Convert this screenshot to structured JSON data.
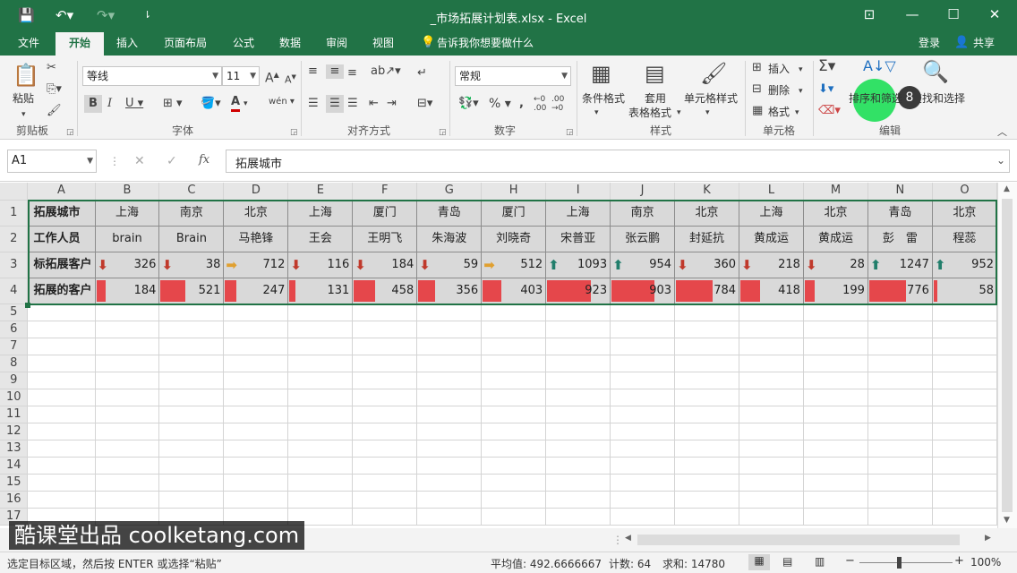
{
  "title": "_市场拓展计划表.xlsx - Excel",
  "tabs": [
    "文件",
    "开始",
    "插入",
    "页面布局",
    "公式",
    "数据",
    "审阅",
    "视图"
  ],
  "tellme": "告诉我你想要做什么",
  "login": "登录",
  "share": "共享",
  "ribbon": {
    "paste": "粘贴",
    "font_name": "等线",
    "font_size": "11",
    "number_format": "常规",
    "cond_format": "条件格式",
    "table_format_1": "套用",
    "table_format_2": "表格格式",
    "cell_style": "单元格样式",
    "insert": "插入",
    "delete": "删除",
    "format": "格式",
    "sort_filter": "排序和筛选",
    "find_select": "查找和选择",
    "groups": {
      "clipboard": "剪贴板",
      "font": "字体",
      "align": "对齐方式",
      "number": "数字",
      "style": "样式",
      "cells": "单元格",
      "edit": "编辑"
    }
  },
  "namebox": "A1",
  "formula": "拓展城市",
  "fx": "fx",
  "columns": [
    "A",
    "B",
    "C",
    "D",
    "E",
    "F",
    "G",
    "H",
    "I",
    "J",
    "K",
    "L",
    "M",
    "N",
    "O"
  ],
  "rows": [
    "1",
    "2",
    "3",
    "4",
    "5",
    "6",
    "7",
    "8",
    "9",
    "10",
    "11",
    "12",
    "13",
    "14",
    "15",
    "16",
    "17"
  ],
  "sheet": {
    "row1_label": "拓展城市",
    "row2_label": "工作人员",
    "row3_label": "标拓展客户",
    "row4_label": "拓展的客户",
    "cities": [
      "上海",
      "南京",
      "北京",
      "上海",
      "厦门",
      "青岛",
      "厦门",
      "上海",
      "南京",
      "北京",
      "上海",
      "北京",
      "青岛",
      "北京"
    ],
    "staff": [
      "brain",
      "Brain",
      "马艳锋",
      "王会",
      "王明飞",
      "朱海波",
      "刘晓奇",
      "宋普亚",
      "张云鹏",
      "封延抗",
      "黄成运",
      "黄成运",
      "彭　雷",
      "程蕊"
    ],
    "targets": [
      326,
      38,
      712,
      116,
      184,
      59,
      512,
      1093,
      954,
      360,
      218,
      28,
      1247,
      952
    ],
    "target_icons": [
      "down",
      "down",
      "side",
      "down",
      "down",
      "down",
      "side",
      "up",
      "up",
      "down",
      "down",
      "down",
      "up",
      "up"
    ],
    "actual": [
      184,
      521,
      247,
      131,
      458,
      356,
      403,
      923,
      903,
      784,
      418,
      199,
      776,
      58
    ],
    "actual_max": 1247
  },
  "colors": {
    "accent": "#217346",
    "arrow_up": "#217e6b",
    "arrow_down": "#c0392b",
    "arrow_side": "#e0a030",
    "bar": "#e5474b"
  },
  "status": {
    "message": "选定目标区域，然后按 ENTER 或选择“粘贴”",
    "average": "平均值: 492.6666667",
    "count": "计数: 64",
    "sum": "求和: 14780",
    "zoom": "100%"
  },
  "badge": "8",
  "watermark": "酷课堂出品 coolketang.com"
}
